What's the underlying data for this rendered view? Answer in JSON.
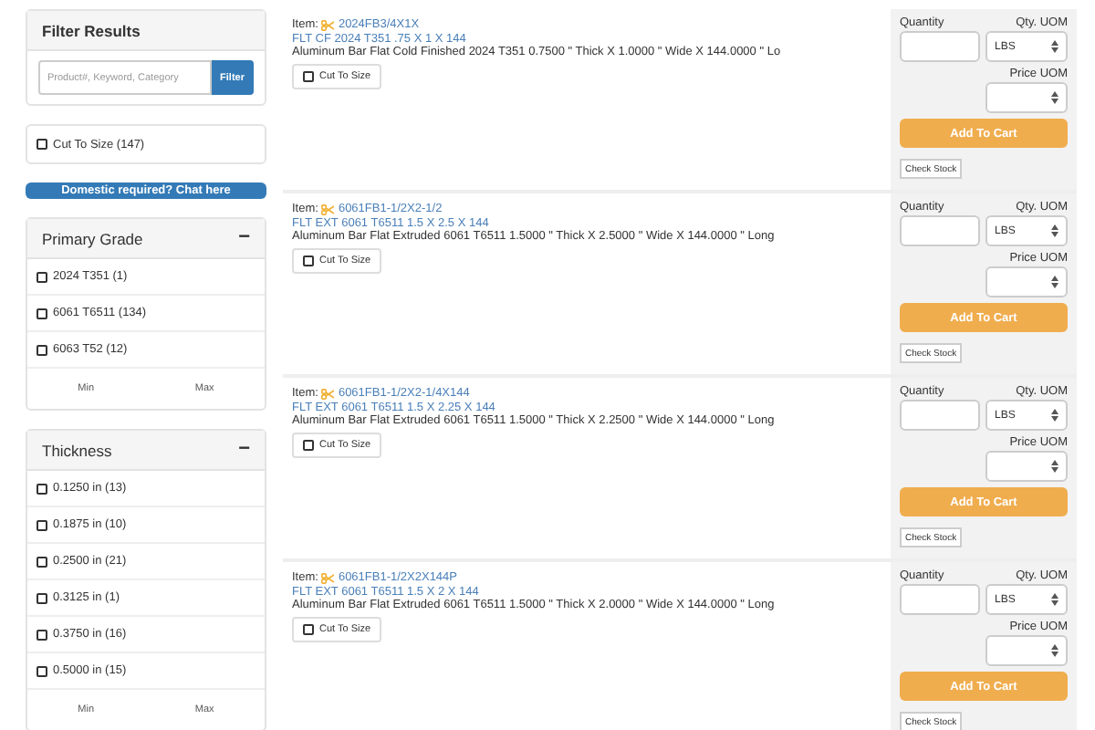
{
  "filter": {
    "title": "Filter Results",
    "search": {
      "placeholder": "Product#, Keyword, Category"
    },
    "button": "Filter"
  },
  "cut_to_size": {
    "label": "Cut To Size (147)",
    "checked": false
  },
  "chat_button": "Domestic required? Chat here",
  "facets": [
    {
      "title": "Primary Grade",
      "toggle": "−",
      "expanded": true,
      "options": [
        {
          "label": "2024 T351 (1)",
          "checked": false
        },
        {
          "label": "6061 T6511 (134)",
          "checked": false
        },
        {
          "label": "6063 T52 (12)",
          "checked": false
        }
      ],
      "min": "Min",
      "max": "Max"
    },
    {
      "title": "Thickness",
      "toggle": "−",
      "expanded": true,
      "options": [
        {
          "label": "0.1250 in (13)",
          "checked": false
        },
        {
          "label": "0.1875 in (10)",
          "checked": false
        },
        {
          "label": "0.2500 in (21)",
          "checked": false
        },
        {
          "label": "0.3125 in (1)",
          "checked": false
        },
        {
          "label": "0.3750 in (16)",
          "checked": false
        },
        {
          "label": "0.5000 in (15)",
          "checked": false
        }
      ],
      "min": "Min",
      "max": "Max"
    }
  ],
  "products": [
    {
      "item_label": "Item:",
      "code": "2024FB3/4X1X",
      "name": "FLT CF 2024 T351 .75 X 1 X 144",
      "description": "Aluminum Bar Flat Cold Finished 2024 T351 0.7500 \" Thick X 1.0000 \" Wide X 144.0000 \" Lo",
      "cut_button": "Cut To Size",
      "quantity_label": "Quantity",
      "qty_uom_label": "Qty. UOM",
      "qty_uom": "LBS",
      "price_uom_label": "Price UOM",
      "add_button": "Add To Cart",
      "stock_button": "Check Stock"
    },
    {
      "item_label": "Item:",
      "code": "6061FB1-1/2X2-1/2",
      "name": "FLT EXT 6061 T6511 1.5 X 2.5 X 144",
      "description": "Aluminum Bar Flat Extruded 6061 T6511 1.5000 \" Thick X 2.5000 \" Wide X 144.0000 \" Long",
      "cut_button": "Cut To Size",
      "quantity_label": "Quantity",
      "qty_uom_label": "Qty. UOM",
      "qty_uom": "LBS",
      "price_uom_label": "Price UOM",
      "add_button": "Add To Cart",
      "stock_button": "Check Stock"
    },
    {
      "item_label": "Item:",
      "code": "6061FB1-1/2X2-1/4X144",
      "name": "FLT EXT 6061 T6511 1.5 X 2.25 X 144",
      "description": "Aluminum Bar Flat Extruded 6061 T6511 1.5000 \" Thick X 2.2500 \" Wide X 144.0000 \" Long",
      "cut_button": "Cut To Size",
      "quantity_label": "Quantity",
      "qty_uom_label": "Qty. UOM",
      "qty_uom": "LBS",
      "price_uom_label": "Price UOM",
      "add_button": "Add To Cart",
      "stock_button": "Check Stock"
    },
    {
      "item_label": "Item:",
      "code": "6061FB1-1/2X2X144P",
      "name": "FLT EXT 6061 T6511 1.5 X 2 X 144",
      "description": "Aluminum Bar Flat Extruded 6061 T6511 1.5000 \" Thick X 2.0000 \" Wide X 144.0000 \" Long",
      "cut_button": "Cut To Size",
      "quantity_label": "Quantity",
      "qty_uom_label": "Qty. UOM",
      "qty_uom": "LBS",
      "price_uom_label": "Price UOM",
      "add_button": "Add To Cart",
      "stock_button": "Check Stock"
    }
  ]
}
